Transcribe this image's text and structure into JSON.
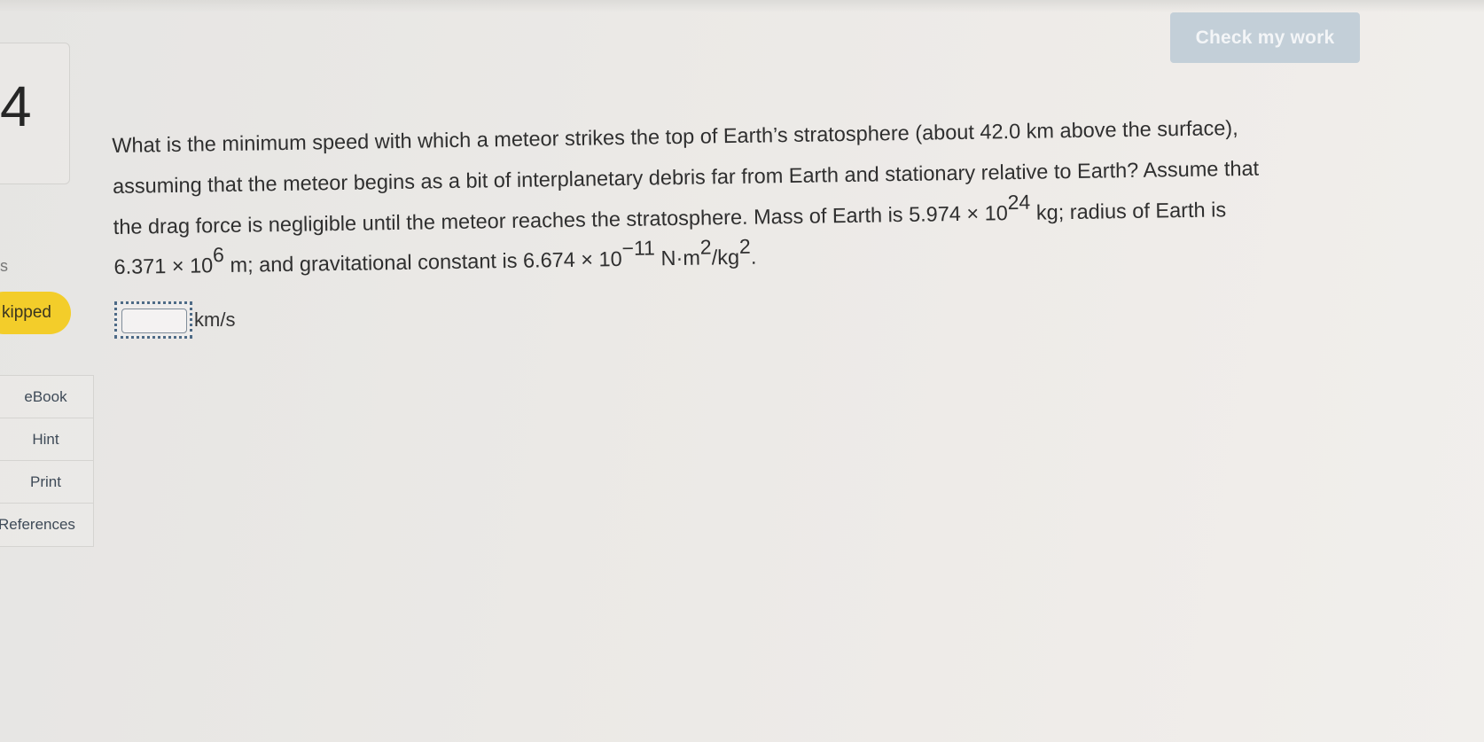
{
  "header": {
    "check_button_label": "Check my work"
  },
  "sidebar": {
    "question_number": "4",
    "points_fragment": "s",
    "status_label": "kipped",
    "tools": [
      {
        "label": "eBook"
      },
      {
        "label": "Hint"
      },
      {
        "label": "Print"
      },
      {
        "label": "References"
      }
    ]
  },
  "question": {
    "line1": "What is the minimum speed with which a meteor strikes the top of Earth’s stratosphere (about 42.0 km above the surface),",
    "line2": "assuming that the meteor begins as a bit of interplanetary debris far from Earth and stationary relative to Earth? Assume that",
    "line3_text": "the drag force is negligible until the meteor reaches the stratosphere. Mass of Earth is 5.974 × 10",
    "line3_exp": "24",
    "line3_tail": " kg; radius of Earth is",
    "line4_a": "6.371 × 10",
    "line4_a_exp": "6",
    "line4_b": " m; and gravitational constant is 6.674 × 10",
    "line4_b_exp": "−11",
    "line4_c": " N·m",
    "line4_c_exp": "2",
    "line4_d": "/kg",
    "line4_d_exp": "2",
    "line4_e": "."
  },
  "answer": {
    "value": "",
    "unit": "km/s"
  }
}
